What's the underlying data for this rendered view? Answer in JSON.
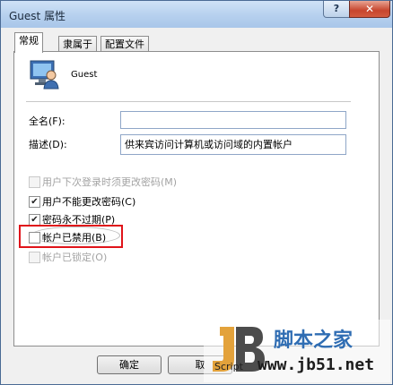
{
  "window": {
    "title": "Guest 属性",
    "help_label": "?",
    "close_label": "✕"
  },
  "tabs": [
    {
      "label": "常规",
      "active": true
    },
    {
      "label": "隶属于",
      "active": false
    },
    {
      "label": "配置文件",
      "active": false
    }
  ],
  "user": {
    "name": "Guest",
    "icon": "user-monitor-icon"
  },
  "fields": {
    "fullname_label": "全名(F):",
    "fullname_value": "",
    "description_label": "描述(D):",
    "description_value": "供来宾访问计算机或访问域的内置帐户"
  },
  "checkboxes": [
    {
      "label": "用户下次登录时须更改密码(M)",
      "checked": false,
      "enabled": false
    },
    {
      "label": "用户不能更改密码(C)",
      "checked": true,
      "enabled": true
    },
    {
      "label": "密码永不过期(P)",
      "checked": true,
      "enabled": true
    },
    {
      "label": "帐户已禁用(B)",
      "checked": false,
      "enabled": true
    },
    {
      "label": "帐户已锁定(O)",
      "checked": false,
      "enabled": false
    }
  ],
  "buttons": {
    "ok": "确定",
    "cancel": "取"
  },
  "watermark": {
    "brand": "脚本之家",
    "script": "Script",
    "site": "www.jb51.net"
  },
  "colors": {
    "highlight": "#e0141a",
    "accent": "#4a6a94"
  }
}
